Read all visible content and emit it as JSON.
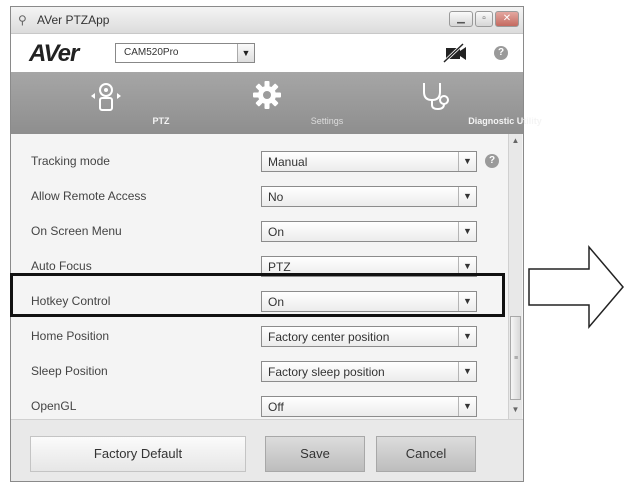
{
  "window": {
    "title": "AVer PTZApp",
    "app_icon": "camera-app-icon",
    "controls": [
      "minimize-icon",
      "maximize-icon",
      "close-icon"
    ]
  },
  "header": {
    "logo": "AVer",
    "camera_select": {
      "value": "CAM520Pro"
    },
    "mute_icon": "camera-muted-icon",
    "help": "?"
  },
  "tabs": [
    {
      "label": "PTZ",
      "icon": "ptz-icon"
    },
    {
      "label": "Settings",
      "icon": "gear-icon"
    },
    {
      "label": "Diagnostic Utility",
      "icon": "stethoscope-icon"
    }
  ],
  "settings": [
    {
      "label": "Tracking mode",
      "value": "Manual"
    },
    {
      "label": "Allow Remote Access",
      "value": "No"
    },
    {
      "label": "On Screen Menu",
      "value": "On"
    },
    {
      "label": "Auto Focus",
      "value": "PTZ"
    },
    {
      "label": "Hotkey Control",
      "value": "On"
    },
    {
      "label": "Home Position",
      "value": "Factory center position"
    },
    {
      "label": "Sleep Position",
      "value": "Factory sleep position"
    },
    {
      "label": "OpenGL",
      "value": "Off"
    }
  ],
  "row_help": "?",
  "footer": {
    "factory_default": "Factory Default",
    "save": "Save",
    "cancel": "Cancel"
  },
  "colors": {
    "tab_bar": "#999999",
    "highlight": "#111111"
  }
}
